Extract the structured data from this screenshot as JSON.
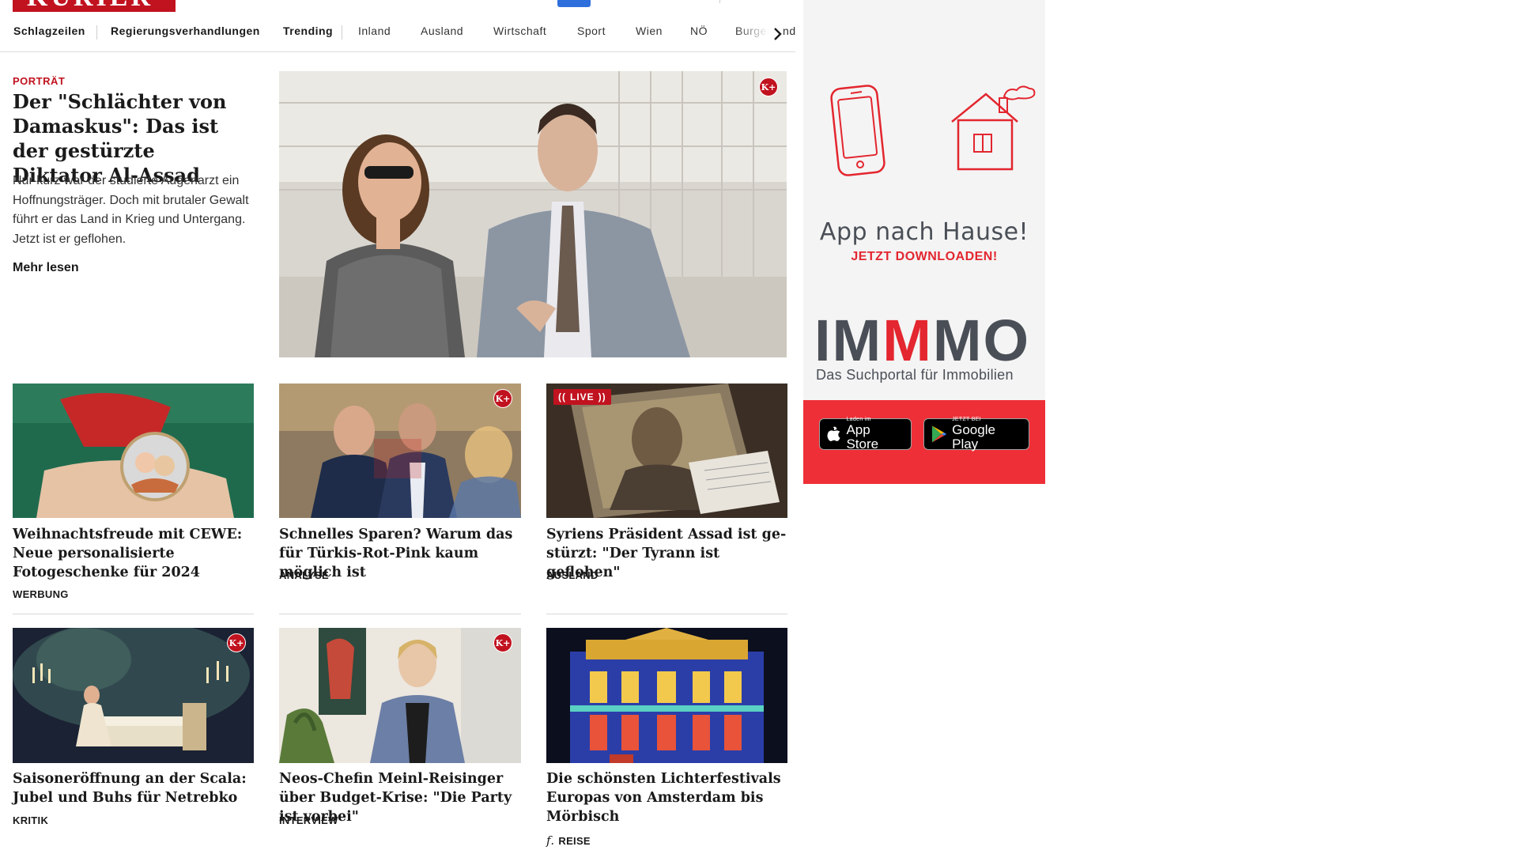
{
  "header": {
    "logo_text": "KURIER"
  },
  "nav": {
    "items": [
      {
        "label": "Schlagzeilen"
      },
      {
        "label": "Regierungsverhandlungen"
      },
      {
        "label": "Trending"
      },
      {
        "label": "Inland"
      },
      {
        "label": "Ausland"
      },
      {
        "label": "Wirtschaft"
      },
      {
        "label": "Sport"
      },
      {
        "label": "Wien"
      },
      {
        "label": "NÖ"
      },
      {
        "label": "Burgenland"
      }
    ],
    "scroll_icon": "chevron-right-icon"
  },
  "hero": {
    "kicker": "PORTRÄT",
    "title": "Der \"Schlächter von Da­maskus\": Das ist der ge­stürzte Diktator Al-Assad",
    "teaser": "Nur kurz war der studierte Augenarzt ein Hoffnungsträger. Doch mit brutaler Gewalt führt er das Land in Krieg und Untergang. Jetzt ist er geflohen.",
    "more_label": "Mehr lesen",
    "premium_badge": "K+"
  },
  "cards": [
    {
      "title": "Weihnachtsfreude mit CEWE: Neue personalisierte Fotogeschenke für 2024",
      "tag": "WERBUNG"
    },
    {
      "title": "Schnelles Sparen? Warum das für Türkis-Rot-Pink kaum möglich ist",
      "tag": "ANALYSE",
      "badge": "K+"
    },
    {
      "title": "Syriens Präsident Assad ist ge­stürzt: \"Der Tyrann ist geflohen\"",
      "tag": "AUSLAND",
      "live_label": "LIVE"
    },
    {
      "title": "Saisoneröffnung an der Scala: Ju­bel und Buhs für Netrebko",
      "tag": "KRITIK",
      "badge": "K+"
    },
    {
      "title": "Neos-Chefin Meinl-Reisinger über Budget-Krise: \"Die Party ist vorbei\"",
      "tag": "INTERVIEW",
      "badge": "K+"
    },
    {
      "title": "Die schönsten Lichterfestivals Eu­ropas von Amsterdam bis Mörbisch",
      "tag": "REISE",
      "tag_icon": "freizeit-icon"
    }
  ],
  "ad": {
    "headline": "App nach Hause!",
    "subline": "JETZT DOWNLOADEN!",
    "brand_pre": "IM",
    "brand_accent": "M",
    "brand_post": "MO",
    "tagline": "Das Suchportal für Immobilien",
    "appstore_small": "Laden im",
    "appstore_big": "App Store",
    "googleplay_small": "JETZT BEI",
    "googleplay_big": "Google Play"
  },
  "colors": {
    "brand_red": "#c1121f",
    "ad_red": "#ee2f37",
    "ad_grey": "#4a4f57"
  }
}
